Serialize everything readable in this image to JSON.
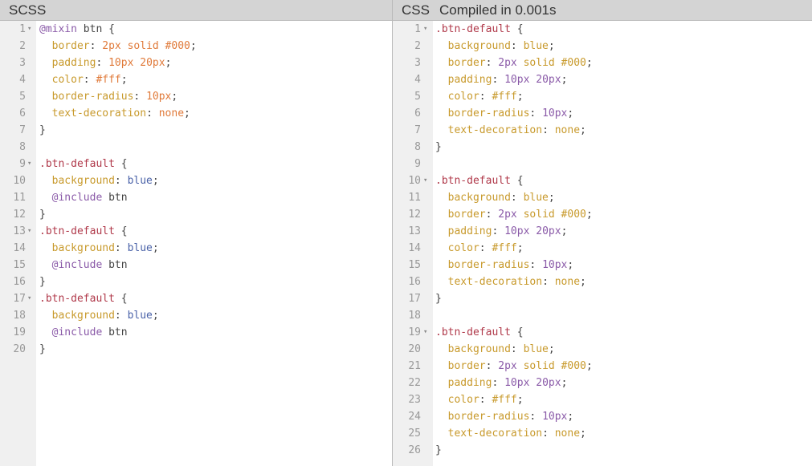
{
  "scss_pane": {
    "title": "SCSS",
    "lines": [
      {
        "n": "1",
        "fold": true,
        "tokens": [
          {
            "t": "@mixin",
            "c": "atrule"
          },
          {
            "t": " btn {",
            "c": "name"
          }
        ]
      },
      {
        "n": "2",
        "fold": false,
        "tokens": [
          {
            "t": "  border",
            "c": "prop"
          },
          {
            "t": ": ",
            "c": "punc"
          },
          {
            "t": "2px solid #000",
            "c": "num"
          },
          {
            "t": ";",
            "c": "punc"
          }
        ]
      },
      {
        "n": "3",
        "fold": false,
        "tokens": [
          {
            "t": "  padding",
            "c": "prop"
          },
          {
            "t": ": ",
            "c": "punc"
          },
          {
            "t": "10px 20px",
            "c": "num"
          },
          {
            "t": ";",
            "c": "punc"
          }
        ]
      },
      {
        "n": "4",
        "fold": false,
        "tokens": [
          {
            "t": "  color",
            "c": "prop"
          },
          {
            "t": ": ",
            "c": "punc"
          },
          {
            "t": "#fff",
            "c": "num"
          },
          {
            "t": ";",
            "c": "punc"
          }
        ]
      },
      {
        "n": "5",
        "fold": false,
        "tokens": [
          {
            "t": "  border-radius",
            "c": "prop"
          },
          {
            "t": ": ",
            "c": "punc"
          },
          {
            "t": "10px",
            "c": "num"
          },
          {
            "t": ";",
            "c": "punc"
          }
        ]
      },
      {
        "n": "6",
        "fold": false,
        "tokens": [
          {
            "t": "  text-decoration",
            "c": "prop"
          },
          {
            "t": ": ",
            "c": "punc"
          },
          {
            "t": "none",
            "c": "num"
          },
          {
            "t": ";",
            "c": "punc"
          }
        ]
      },
      {
        "n": "7",
        "fold": false,
        "tokens": [
          {
            "t": "}",
            "c": "punc"
          }
        ]
      },
      {
        "n": "8",
        "fold": false,
        "tokens": []
      },
      {
        "n": "9",
        "fold": true,
        "tokens": [
          {
            "t": ".btn-default",
            "c": "sel"
          },
          {
            "t": " {",
            "c": "punc"
          }
        ]
      },
      {
        "n": "10",
        "fold": false,
        "tokens": [
          {
            "t": "  background",
            "c": "prop"
          },
          {
            "t": ": ",
            "c": "punc"
          },
          {
            "t": "blue",
            "c": "blue"
          },
          {
            "t": ";",
            "c": "punc"
          }
        ]
      },
      {
        "n": "11",
        "fold": false,
        "tokens": [
          {
            "t": "  @include",
            "c": "atrule"
          },
          {
            "t": " btn",
            "c": "name"
          }
        ]
      },
      {
        "n": "12",
        "fold": false,
        "tokens": [
          {
            "t": "}",
            "c": "punc"
          }
        ]
      },
      {
        "n": "13",
        "fold": true,
        "tokens": [
          {
            "t": ".btn-default",
            "c": "sel"
          },
          {
            "t": " {",
            "c": "punc"
          }
        ]
      },
      {
        "n": "14",
        "fold": false,
        "tokens": [
          {
            "t": "  background",
            "c": "prop"
          },
          {
            "t": ": ",
            "c": "punc"
          },
          {
            "t": "blue",
            "c": "blue"
          },
          {
            "t": ";",
            "c": "punc"
          }
        ]
      },
      {
        "n": "15",
        "fold": false,
        "tokens": [
          {
            "t": "  @include",
            "c": "atrule"
          },
          {
            "t": " btn",
            "c": "name"
          }
        ]
      },
      {
        "n": "16",
        "fold": false,
        "tokens": [
          {
            "t": "}",
            "c": "punc"
          }
        ]
      },
      {
        "n": "17",
        "fold": true,
        "tokens": [
          {
            "t": ".btn-default",
            "c": "sel"
          },
          {
            "t": " {",
            "c": "punc"
          }
        ]
      },
      {
        "n": "18",
        "fold": false,
        "tokens": [
          {
            "t": "  background",
            "c": "prop"
          },
          {
            "t": ": ",
            "c": "punc"
          },
          {
            "t": "blue",
            "c": "blue"
          },
          {
            "t": ";",
            "c": "punc"
          }
        ]
      },
      {
        "n": "19",
        "fold": false,
        "tokens": [
          {
            "t": "  @include",
            "c": "atrule"
          },
          {
            "t": " btn",
            "c": "name"
          }
        ]
      },
      {
        "n": "20",
        "fold": false,
        "tokens": [
          {
            "t": "}",
            "c": "punc"
          }
        ]
      }
    ]
  },
  "css_pane": {
    "title": "CSS",
    "status": "Compiled in 0.001s",
    "lines": [
      {
        "n": "1",
        "fold": true,
        "tokens": [
          {
            "t": ".btn-default",
            "c": "sel"
          },
          {
            "t": " {",
            "c": "punc"
          }
        ]
      },
      {
        "n": "2",
        "fold": false,
        "tokens": [
          {
            "t": "  background",
            "c": "prop"
          },
          {
            "t": ": ",
            "c": "punc"
          },
          {
            "t": "blue",
            "c": "kw"
          },
          {
            "t": ";",
            "c": "punc"
          }
        ]
      },
      {
        "n": "3",
        "fold": false,
        "tokens": [
          {
            "t": "  border",
            "c": "prop"
          },
          {
            "t": ": ",
            "c": "punc"
          },
          {
            "t": "2px",
            "c": "px"
          },
          {
            "t": " solid #000",
            "c": "hex"
          },
          {
            "t": ";",
            "c": "punc"
          }
        ]
      },
      {
        "n": "4",
        "fold": false,
        "tokens": [
          {
            "t": "  padding",
            "c": "prop"
          },
          {
            "t": ": ",
            "c": "punc"
          },
          {
            "t": "10px 20px",
            "c": "px"
          },
          {
            "t": ";",
            "c": "punc"
          }
        ]
      },
      {
        "n": "5",
        "fold": false,
        "tokens": [
          {
            "t": "  color",
            "c": "prop"
          },
          {
            "t": ": ",
            "c": "punc"
          },
          {
            "t": "#fff",
            "c": "hex"
          },
          {
            "t": ";",
            "c": "punc"
          }
        ]
      },
      {
        "n": "6",
        "fold": false,
        "tokens": [
          {
            "t": "  border-radius",
            "c": "prop"
          },
          {
            "t": ": ",
            "c": "punc"
          },
          {
            "t": "10px",
            "c": "px"
          },
          {
            "t": ";",
            "c": "punc"
          }
        ]
      },
      {
        "n": "7",
        "fold": false,
        "tokens": [
          {
            "t": "  text-decoration",
            "c": "prop"
          },
          {
            "t": ": ",
            "c": "punc"
          },
          {
            "t": "none",
            "c": "kw"
          },
          {
            "t": ";",
            "c": "punc"
          }
        ]
      },
      {
        "n": "8",
        "fold": false,
        "tokens": [
          {
            "t": "}",
            "c": "punc"
          }
        ]
      },
      {
        "n": "9",
        "fold": false,
        "tokens": []
      },
      {
        "n": "10",
        "fold": true,
        "tokens": [
          {
            "t": ".btn-default",
            "c": "sel"
          },
          {
            "t": " {",
            "c": "punc"
          }
        ]
      },
      {
        "n": "11",
        "fold": false,
        "tokens": [
          {
            "t": "  background",
            "c": "prop"
          },
          {
            "t": ": ",
            "c": "punc"
          },
          {
            "t": "blue",
            "c": "kw"
          },
          {
            "t": ";",
            "c": "punc"
          }
        ]
      },
      {
        "n": "12",
        "fold": false,
        "tokens": [
          {
            "t": "  border",
            "c": "prop"
          },
          {
            "t": ": ",
            "c": "punc"
          },
          {
            "t": "2px",
            "c": "px"
          },
          {
            "t": " solid #000",
            "c": "hex"
          },
          {
            "t": ";",
            "c": "punc"
          }
        ]
      },
      {
        "n": "13",
        "fold": false,
        "tokens": [
          {
            "t": "  padding",
            "c": "prop"
          },
          {
            "t": ": ",
            "c": "punc"
          },
          {
            "t": "10px 20px",
            "c": "px"
          },
          {
            "t": ";",
            "c": "punc"
          }
        ]
      },
      {
        "n": "14",
        "fold": false,
        "tokens": [
          {
            "t": "  color",
            "c": "prop"
          },
          {
            "t": ": ",
            "c": "punc"
          },
          {
            "t": "#fff",
            "c": "hex"
          },
          {
            "t": ";",
            "c": "punc"
          }
        ]
      },
      {
        "n": "15",
        "fold": false,
        "tokens": [
          {
            "t": "  border-radius",
            "c": "prop"
          },
          {
            "t": ": ",
            "c": "punc"
          },
          {
            "t": "10px",
            "c": "px"
          },
          {
            "t": ";",
            "c": "punc"
          }
        ]
      },
      {
        "n": "16",
        "fold": false,
        "tokens": [
          {
            "t": "  text-decoration",
            "c": "prop"
          },
          {
            "t": ": ",
            "c": "punc"
          },
          {
            "t": "none",
            "c": "kw"
          },
          {
            "t": ";",
            "c": "punc"
          }
        ]
      },
      {
        "n": "17",
        "fold": false,
        "tokens": [
          {
            "t": "}",
            "c": "punc"
          }
        ]
      },
      {
        "n": "18",
        "fold": false,
        "tokens": []
      },
      {
        "n": "19",
        "fold": true,
        "tokens": [
          {
            "t": ".btn-default",
            "c": "sel"
          },
          {
            "t": " {",
            "c": "punc"
          }
        ]
      },
      {
        "n": "20",
        "fold": false,
        "tokens": [
          {
            "t": "  background",
            "c": "prop"
          },
          {
            "t": ": ",
            "c": "punc"
          },
          {
            "t": "blue",
            "c": "kw"
          },
          {
            "t": ";",
            "c": "punc"
          }
        ]
      },
      {
        "n": "21",
        "fold": false,
        "tokens": [
          {
            "t": "  border",
            "c": "prop"
          },
          {
            "t": ": ",
            "c": "punc"
          },
          {
            "t": "2px",
            "c": "px"
          },
          {
            "t": " solid #000",
            "c": "hex"
          },
          {
            "t": ";",
            "c": "punc"
          }
        ]
      },
      {
        "n": "22",
        "fold": false,
        "tokens": [
          {
            "t": "  padding",
            "c": "prop"
          },
          {
            "t": ": ",
            "c": "punc"
          },
          {
            "t": "10px 20px",
            "c": "px"
          },
          {
            "t": ";",
            "c": "punc"
          }
        ]
      },
      {
        "n": "23",
        "fold": false,
        "tokens": [
          {
            "t": "  color",
            "c": "prop"
          },
          {
            "t": ": ",
            "c": "punc"
          },
          {
            "t": "#fff",
            "c": "hex"
          },
          {
            "t": ";",
            "c": "punc"
          }
        ]
      },
      {
        "n": "24",
        "fold": false,
        "tokens": [
          {
            "t": "  border-radius",
            "c": "prop"
          },
          {
            "t": ": ",
            "c": "punc"
          },
          {
            "t": "10px",
            "c": "px"
          },
          {
            "t": ";",
            "c": "punc"
          }
        ]
      },
      {
        "n": "25",
        "fold": false,
        "tokens": [
          {
            "t": "  text-decoration",
            "c": "prop"
          },
          {
            "t": ": ",
            "c": "punc"
          },
          {
            "t": "none",
            "c": "kw"
          },
          {
            "t": ";",
            "c": "punc"
          }
        ]
      },
      {
        "n": "26",
        "fold": false,
        "tokens": [
          {
            "t": "}",
            "c": "punc"
          }
        ]
      }
    ]
  },
  "icons": {
    "fold_glyph": "▾"
  }
}
